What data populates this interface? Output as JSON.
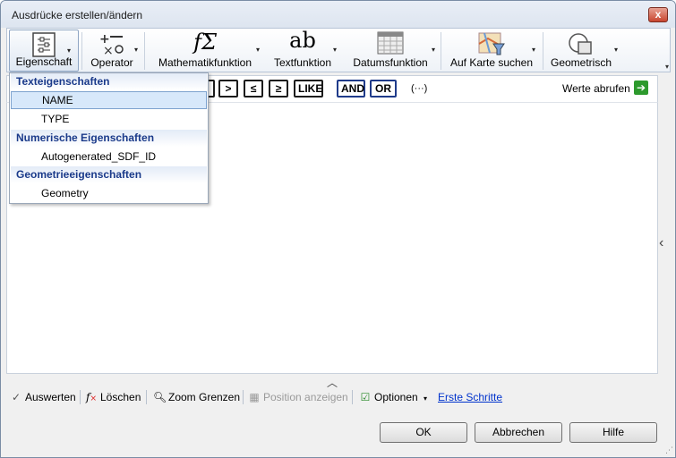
{
  "window": {
    "title": "Ausdrücke erstellen/ändern",
    "close_label": "x"
  },
  "ribbon": {
    "buttons": [
      {
        "label": "Eigenschaft",
        "icon": "property-list-icon"
      },
      {
        "label": "Operator",
        "icon": "operator-icon"
      },
      {
        "label": "Mathematikfunktion",
        "icon": "math-function-icon",
        "glyph": "fΣ"
      },
      {
        "label": "Textfunktion",
        "icon": "text-function-icon",
        "glyph": "ab"
      },
      {
        "label": "Datumsfunktion",
        "icon": "calendar-icon"
      },
      {
        "label": "Auf Karte suchen",
        "icon": "map-search-icon"
      },
      {
        "label": "Geometrisch",
        "icon": "geometry-icon"
      }
    ],
    "dropdown_glyph": "▾"
  },
  "operators": {
    "visible": [
      "",
      ">",
      "≤",
      "≥",
      "LIKE",
      "AND",
      "OR"
    ],
    "ellipsis": "(···)",
    "fetch_values_label": "Werte abrufen"
  },
  "dropdown": {
    "groups": [
      {
        "title": "Texteigenschaften",
        "items": [
          "NAME",
          "TYPE"
        ]
      },
      {
        "title": "Numerische Eigenschaften",
        "items": [
          "Autogenerated_SDF_ID"
        ]
      },
      {
        "title": "Geometrieeigenschaften",
        "items": [
          "Geometry"
        ]
      }
    ],
    "selected": "NAME"
  },
  "bottombar": {
    "evaluate": "Auswerten",
    "delete": "Löschen",
    "zoom": "Zoom Grenzen",
    "position": "Position anzeigen",
    "options": "Optionen",
    "getting_started": "Erste Schritte"
  },
  "buttons": {
    "ok": "OK",
    "cancel": "Abbrechen",
    "help": "Hilfe"
  },
  "colors": {
    "link": "#0033cc",
    "group_header": "#1a3a8a",
    "selection": "#d7e8fa",
    "go_arrow": "#2d9a2d"
  }
}
